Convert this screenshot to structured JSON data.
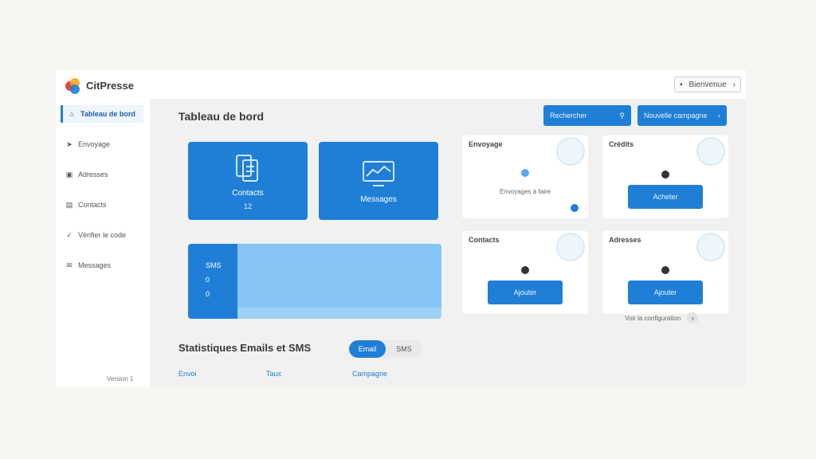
{
  "app": {
    "name": "CitPresse"
  },
  "header": {
    "language": "Bienvenue"
  },
  "sidebar": {
    "items": [
      {
        "label": "Tableau de bord",
        "icon": "home-icon"
      },
      {
        "label": "Envoyage",
        "icon": "send-icon"
      },
      {
        "label": "Adresses",
        "icon": "address-icon"
      },
      {
        "label": "Contacts",
        "icon": "contacts-icon"
      },
      {
        "label": "Vérifier le code",
        "icon": "check-icon"
      },
      {
        "label": "Messages",
        "icon": "mail-icon"
      }
    ],
    "footer": "Version 1"
  },
  "main": {
    "title": "Tableau de bord",
    "search_label": "Rechercher",
    "primary_button": "Nouvelle campagne",
    "tiles": [
      {
        "label": "Contacts",
        "sub": "12",
        "icon": "documents-icon"
      },
      {
        "label": "Messages",
        "sub": "",
        "icon": "monitor-icon"
      }
    ],
    "panel": {
      "items": [
        "SMS",
        "0",
        "0"
      ]
    },
    "cards": [
      {
        "title": "Envoyage",
        "text": "Envoyages à faire",
        "button": ""
      },
      {
        "title": "Crédits",
        "text": "",
        "button": "Acheter"
      },
      {
        "title": "Contacts",
        "text": "",
        "button": "Ajouter"
      },
      {
        "title": "Adresses",
        "text": "",
        "button": "Ajouter"
      }
    ],
    "config_link": "Voir la configuration",
    "stats_title": "Statistiques Emails et SMS",
    "toggle": {
      "on": "Email",
      "off": "SMS"
    },
    "columns": [
      "Envoi",
      "Taux",
      "Campagne"
    ]
  },
  "colors": {
    "primary": "#1f7fd6",
    "light": "#85c4f4"
  }
}
